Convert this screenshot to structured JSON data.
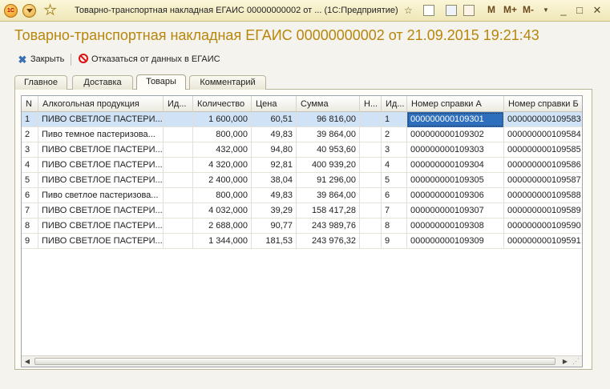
{
  "window": {
    "title": "Товарно-транспортная накладная ЕГАИС 00000000002 от ...  (1С:Предприятие)",
    "m_buttons": [
      "M",
      "M+",
      "M-"
    ]
  },
  "document": {
    "title": "Товарно-транспортная накладная ЕГАИС 00000000002 от 21.09.2015 19:21:43"
  },
  "toolbar": {
    "close_label": "Закрыть",
    "refuse_label": "Отказаться от данных в ЕГАИС"
  },
  "tabs": [
    {
      "label": "Главное"
    },
    {
      "label": "Доставка"
    },
    {
      "label": "Товары",
      "active": true
    },
    {
      "label": "Комментарий"
    }
  ],
  "table": {
    "columns": [
      "N",
      "Алкогольная продукция",
      "Ид...",
      "Количество",
      "Цена",
      "Сумма",
      "Н...",
      "Ид...",
      "Номер справки А",
      "Номер справки Б"
    ],
    "rows": [
      [
        "1",
        "ПИВО СВЕТЛОЕ ПАСТЕРИ...",
        "",
        "1 600,000",
        "60,51",
        "96 816,00",
        "",
        "1",
        "000000000109301",
        "000000000109583"
      ],
      [
        "2",
        "Пиво темное пастеризова...",
        "",
        "800,000",
        "49,83",
        "39 864,00",
        "",
        "2",
        "000000000109302",
        "000000000109584"
      ],
      [
        "3",
        "ПИВО СВЕТЛОЕ ПАСТЕРИ...",
        "",
        "432,000",
        "94,80",
        "40 953,60",
        "",
        "3",
        "000000000109303",
        "000000000109585"
      ],
      [
        "4",
        "ПИВО СВЕТЛОЕ ПАСТЕРИ...",
        "",
        "4 320,000",
        "92,81",
        "400 939,20",
        "",
        "4",
        "000000000109304",
        "000000000109586"
      ],
      [
        "5",
        "ПИВО СВЕТЛОЕ ПАСТЕРИ...",
        "",
        "2 400,000",
        "38,04",
        "91 296,00",
        "",
        "5",
        "000000000109305",
        "000000000109587"
      ],
      [
        "6",
        "Пиво светлое пастеризова...",
        "",
        "800,000",
        "49,83",
        "39 864,00",
        "",
        "6",
        "000000000109306",
        "000000000109588"
      ],
      [
        "7",
        "ПИВО СВЕТЛОЕ ПАСТЕРИ...",
        "",
        "4 032,000",
        "39,29",
        "158 417,28",
        "",
        "7",
        "000000000109307",
        "000000000109589"
      ],
      [
        "8",
        "ПИВО СВЕТЛОЕ ПАСТЕРИ...",
        "",
        "2 688,000",
        "90,77",
        "243 989,76",
        "",
        "8",
        "000000000109308",
        "000000000109590"
      ],
      [
        "9",
        "ПИВО СВЕТЛОЕ ПАСТЕРИ...",
        "",
        "1 344,000",
        "181,53",
        "243 976,32",
        "",
        "9",
        "000000000109309",
        "000000000109591"
      ]
    ],
    "selected_row": 0
  }
}
